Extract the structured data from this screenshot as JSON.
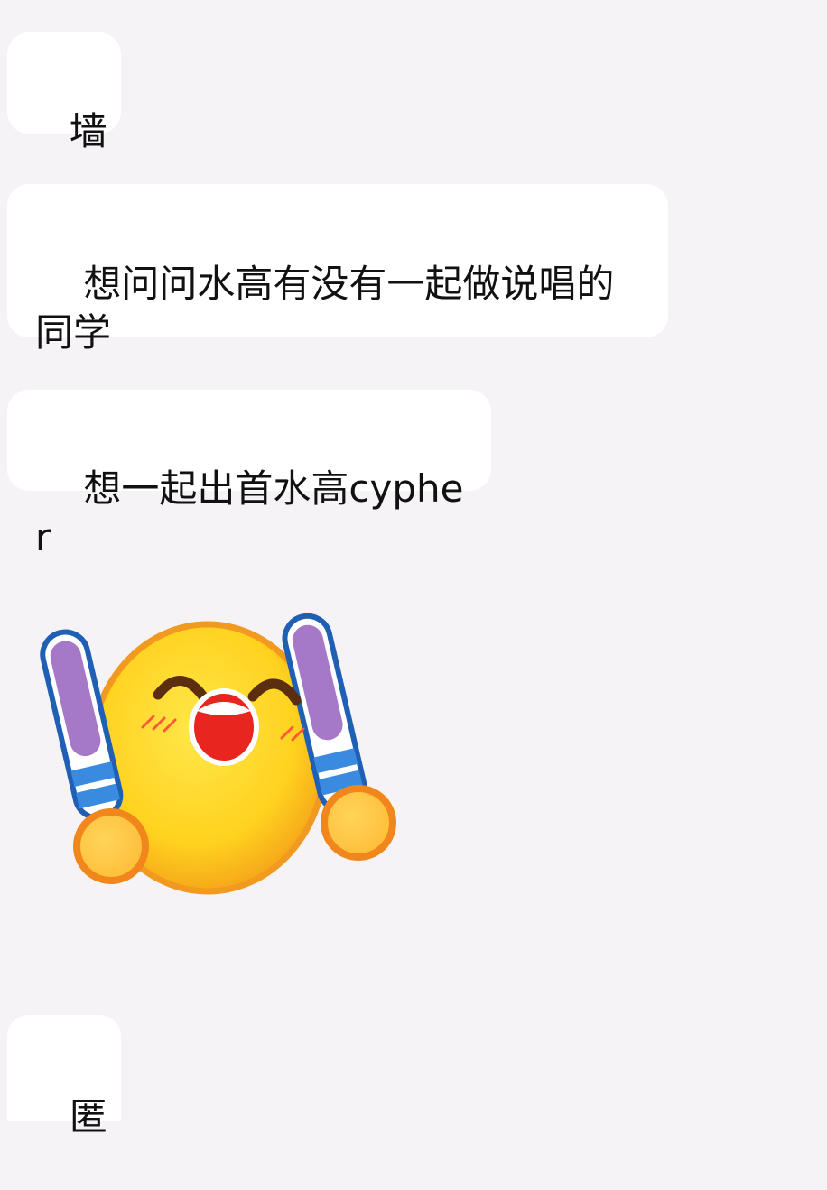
{
  "messages": [
    {
      "text": "墙"
    },
    {
      "text": "想问问水高有没有一起做说唱的同学"
    },
    {
      "text": "想一起出首水高cypher"
    },
    {
      "sticker": "cheering-emoji-sticker"
    },
    {
      "text": "匿"
    }
  ],
  "colors": {
    "background": "#f6f3f6",
    "bubble": "#ffffff",
    "text": "#111111"
  }
}
